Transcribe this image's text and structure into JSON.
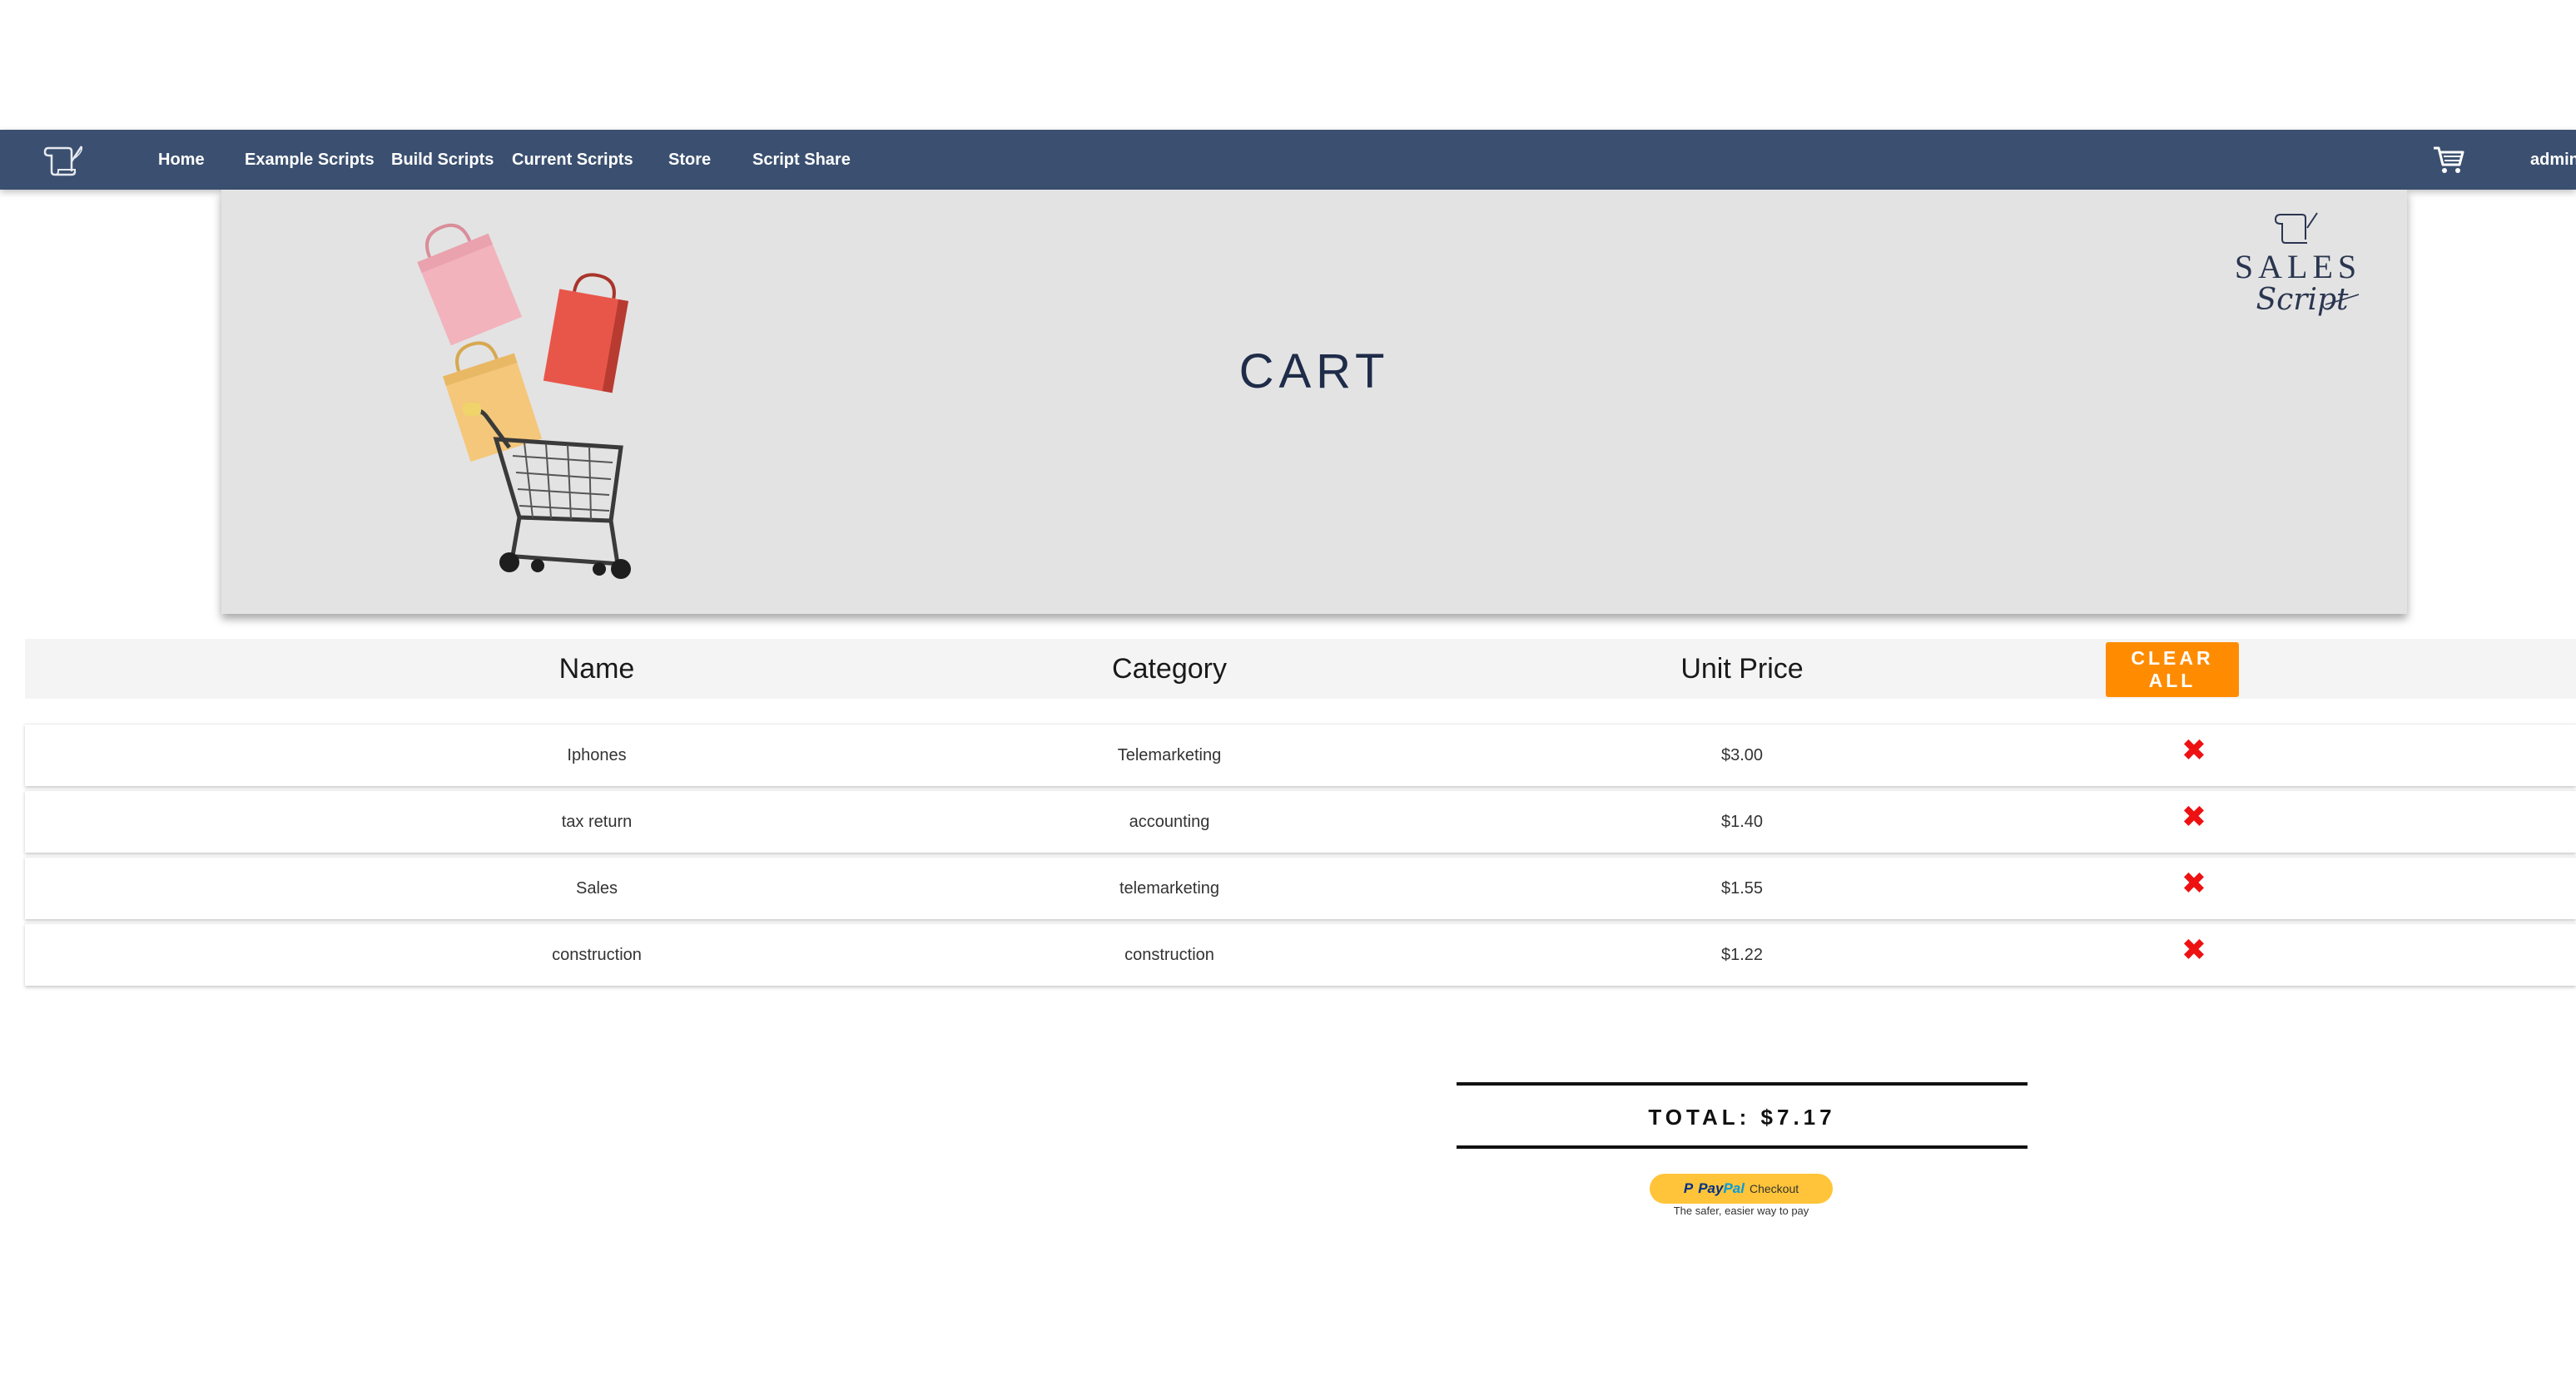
{
  "nav": {
    "items": [
      {
        "label": "Home"
      },
      {
        "label": "Example Scripts"
      },
      {
        "label": "Build Scripts"
      },
      {
        "label": "Current Scripts"
      },
      {
        "label": "Store"
      },
      {
        "label": "Script Share"
      }
    ],
    "user": "admin",
    "cart_icon": "shopping-cart-icon",
    "logo_icon": "scroll-quill-icon"
  },
  "banner": {
    "title": "CART",
    "brand_word": "SALES",
    "brand_script": "Script"
  },
  "table": {
    "headers": {
      "name": "Name",
      "category": "Category",
      "price": "Unit Price"
    },
    "clear_label": "CLEAR ALL",
    "remove_symbol": "✖",
    "rows": [
      {
        "name": "Iphones",
        "category": "Telemarketing",
        "price": "$3.00"
      },
      {
        "name": "tax return",
        "category": "accounting",
        "price": "$1.40"
      },
      {
        "name": "Sales",
        "category": "telemarketing",
        "price": "$1.55"
      },
      {
        "name": "construction",
        "category": "construction",
        "price": "$1.22"
      }
    ]
  },
  "total": {
    "label": "TOTAL: $7.17"
  },
  "paypal": {
    "mark": "P",
    "brand_pay": "Pay",
    "brand_pal": "Pal",
    "checkout": "Checkout",
    "tagline": "The safer, easier way to pay"
  },
  "colors": {
    "navbar": "#3b5070",
    "banner_bg": "#e3e3e3",
    "title": "#1f2c49",
    "clear_button": "#ff8c00",
    "remove_icon": "#ee1111",
    "paypal_button": "#ffc439"
  }
}
